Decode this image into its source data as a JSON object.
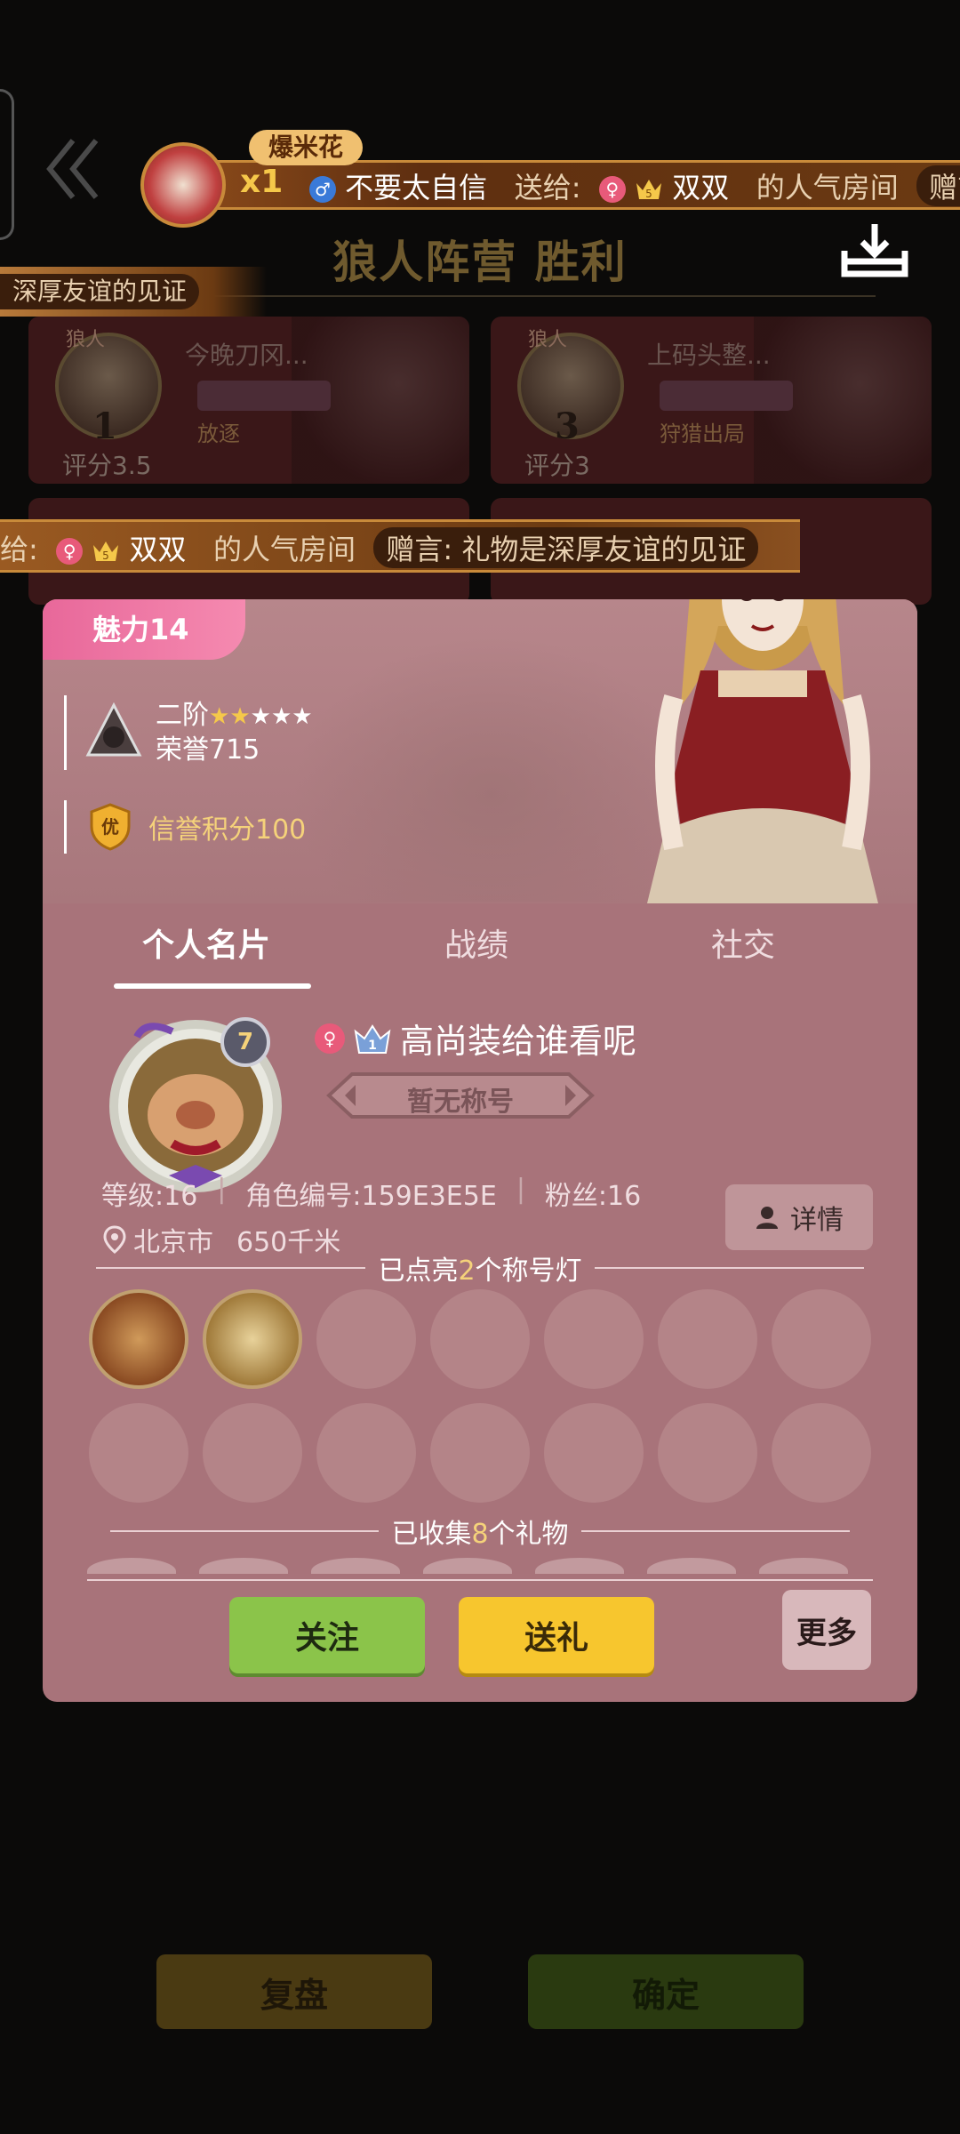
{
  "background": {
    "result_title": "狼人阵营 胜利",
    "players": [
      {
        "role": "狼人",
        "name": "今晚刀冈...",
        "number": "1",
        "score": "评分3.5",
        "status": "放逐"
      },
      {
        "role": "狼人",
        "name": "上码头整...",
        "number": "3",
        "score": "评分3",
        "status": "狩猎出局"
      }
    ],
    "buttons": {
      "replay": "复盘",
      "confirm": "确定"
    }
  },
  "broadcast": {
    "gift_name": "爆米花",
    "gift_count": "x1",
    "sender": "不要太自信",
    "send_to": "送给:",
    "crown_level": "5",
    "receiver": "双双",
    "room": "的人气房间",
    "gift_msg_label": "赠言",
    "gift_msg_label_colon": "赠言:",
    "gift_msg": "礼物是深厚友谊的见证",
    "left_fragment": "深厚友谊的见证",
    "mid_prefix": "给:"
  },
  "profile": {
    "charm_label": "魅力",
    "charm_value": "14",
    "rank_tier": "二阶",
    "rank_stars_filled": 2,
    "rank_stars_total": 5,
    "honor": "荣誉715",
    "credit": "信誉积分100",
    "credit_badge": "优",
    "tabs": [
      "个人名片",
      "战绩",
      "社交"
    ],
    "level_badge": "7",
    "vip_level": "1",
    "nickname": "高尚装给谁看呢",
    "title": "暂无称号",
    "level": "等级:16",
    "role_id": "角色编号:159E3E5E",
    "fans": "粉丝:16",
    "location": "北京市",
    "distance": "650千米",
    "detail_label": "详情",
    "titles_lit_pre": "已点亮",
    "titles_lit_count": "2",
    "titles_lit_post": "个称号灯",
    "gifts_pre": "已收集",
    "gifts_count": "8",
    "gifts_post": "个礼物",
    "follow_label": "关注",
    "gift_label": "送礼",
    "more_label": "更多"
  },
  "colors": {
    "accent_pink": "#e8689a",
    "follow_green": "#8bc44a",
    "gift_yellow": "#f7c62e",
    "modal_bg": "#a8737a"
  }
}
